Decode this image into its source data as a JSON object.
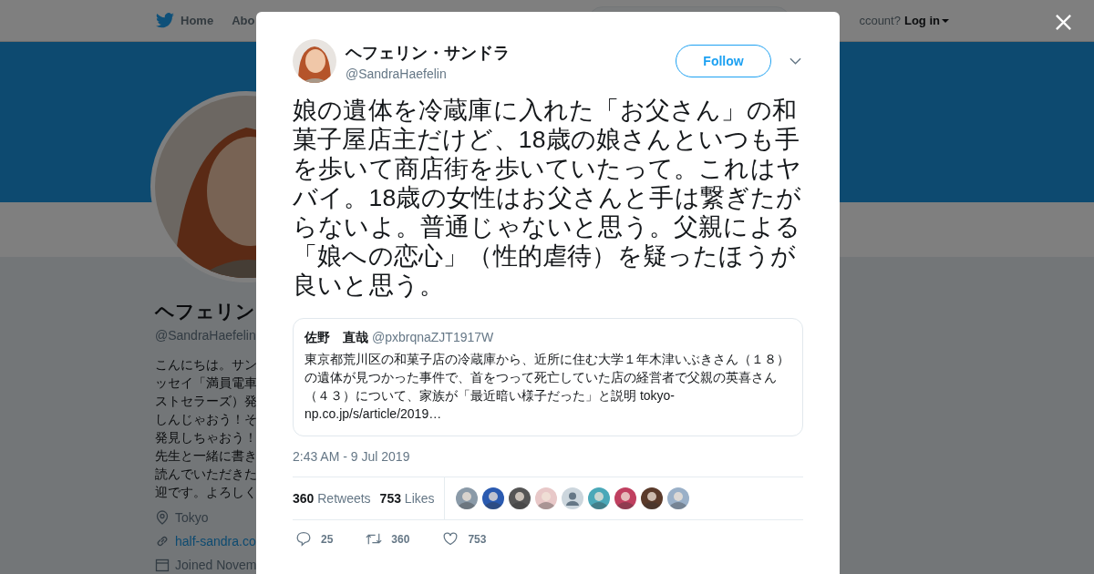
{
  "header": {
    "home": "Home",
    "about": "Abo",
    "account_prompt": "ccount?",
    "login": "Log in"
  },
  "profile": {
    "name": "ヘフェリン",
    "handle": "@SandraHaefelin",
    "bio_lines": [
      "こんにちは。サン",
      "ッセイ「満員電車",
      "ストセラーズ）発",
      "しんじゃおう！そ",
      "発見しちゃおう！",
      "先生と一緒に書き",
      "読んでいただきた",
      "迎です。よろしく"
    ],
    "location": "Tokyo",
    "website": "half-sandra.co",
    "joined": "Joined Novem"
  },
  "tweet": {
    "name": "ヘフェリン・サンドラ",
    "handle": "@SandraHaefelin",
    "follow": "Follow",
    "text": "娘の遺体を冷蔵庫に入れた「お父さん」の和菓子屋店主だけど、18歳の娘さんといつも手を歩いて商店街を歩いていたって。これはヤバイ。18歳の女性はお父さんと手は繋ぎたがらないよ。普通じゃないと思う。父親による「娘への恋心」（性的虐待）を疑ったほうが良いと思う。",
    "quote": {
      "name": "佐野　直哉",
      "handle": "@pxbrqnaZJT1917W",
      "text": "東京都荒川区の和菓子店の冷蔵庫から、近所に住む大学１年木津いぶきさん（１８）の遺体が見つかった事件で、首をつって死亡していた店の経営者で父親の英喜さん（４３）について、家族が「最近暗い様子だった」と説明 tokyo-np.co.jp/s/article/2019…"
    },
    "timestamp": "2:43 AM - 9 Jul 2019",
    "retweets": {
      "count": "360",
      "label": "Retweets"
    },
    "likes": {
      "count": "753",
      "label": "Likes"
    },
    "liked_by": [
      {
        "kind": "picture",
        "color": "#8a9aa8"
      },
      {
        "kind": "picture",
        "color": "#2a5ab0"
      },
      {
        "kind": "picture",
        "color": "#555555"
      },
      {
        "kind": "picture",
        "color": "#e8c8c8"
      },
      {
        "kind": "default",
        "color": "#ccd6dd"
      },
      {
        "kind": "picture",
        "color": "#4aa8b8"
      },
      {
        "kind": "picture",
        "color": "#c04060"
      },
      {
        "kind": "picture",
        "color": "#5a3a2a"
      },
      {
        "kind": "picture",
        "color": "#9ab0c8"
      }
    ],
    "actions": [
      {
        "kind": "reply",
        "count": "25"
      },
      {
        "kind": "retweet",
        "count": "360"
      },
      {
        "kind": "like",
        "count": "753"
      }
    ]
  }
}
